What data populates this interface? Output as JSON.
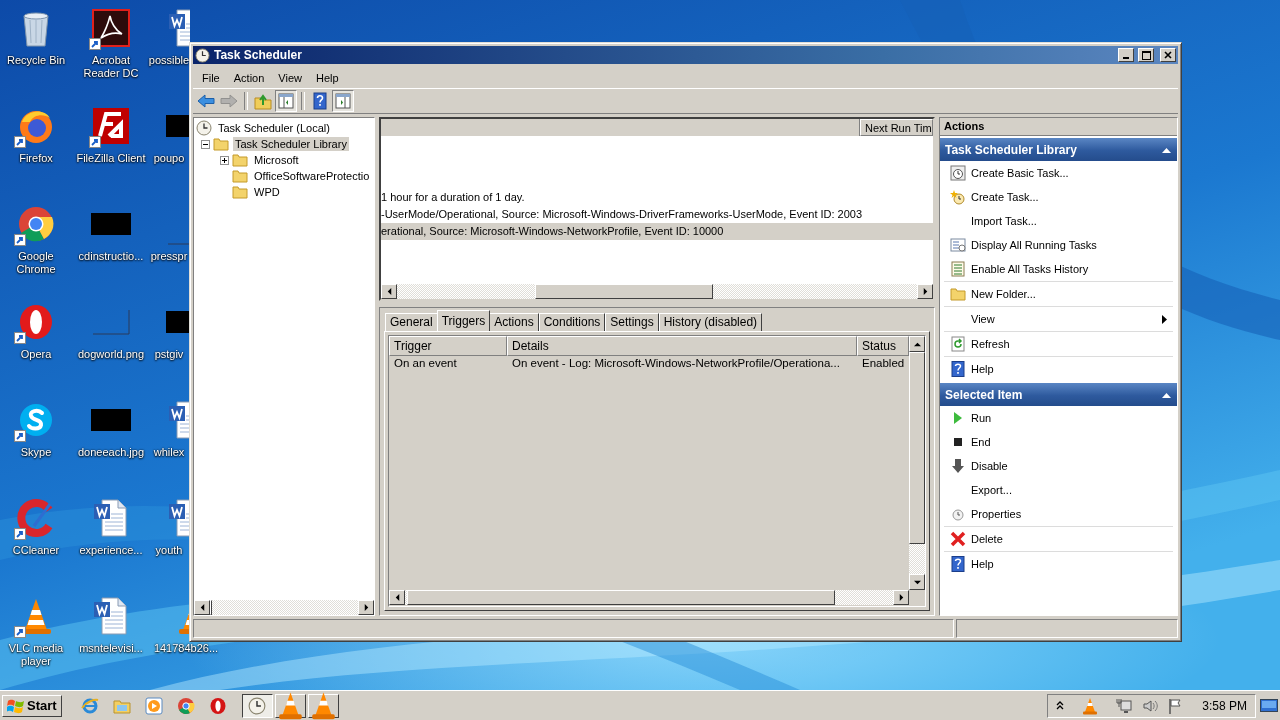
{
  "desktop": {
    "columns": [
      [
        {
          "label": "Recycle Bin",
          "shortcut": false
        },
        {
          "label": "Firefox",
          "shortcut": true
        },
        {
          "label": "Google Chrome",
          "shortcut": true
        },
        {
          "label": "Opera",
          "shortcut": true
        },
        {
          "label": "Skype",
          "shortcut": true
        },
        {
          "label": "CCleaner",
          "shortcut": true
        },
        {
          "label": "VLC media player",
          "shortcut": true
        }
      ],
      [
        {
          "label": "Acrobat Reader DC",
          "shortcut": true
        },
        {
          "label": "FileZilla Client",
          "shortcut": true
        },
        {
          "label": "cdinstructio...",
          "shortcut": false
        },
        {
          "label": "dogworld.png",
          "shortcut": false
        },
        {
          "label": "doneeach.jpg",
          "shortcut": false
        },
        {
          "label": "experience...",
          "shortcut": false
        },
        {
          "label": "msntelevisi...",
          "shortcut": false
        }
      ],
      [
        {
          "label": "possible",
          "shortcut": false
        },
        {
          "label": "poupo",
          "shortcut": false
        },
        {
          "label": "presspr",
          "shortcut": false
        },
        {
          "label": "pstgiv",
          "shortcut": false
        },
        {
          "label": "whilex",
          "shortcut": false
        },
        {
          "label": "youth",
          "shortcut": false
        },
        {
          "label": "141784b26...",
          "shortcut": false
        }
      ]
    ]
  },
  "window": {
    "title": "Task Scheduler",
    "menu": [
      "File",
      "Action",
      "View",
      "Help"
    ],
    "toolbar": [
      {
        "disabled": false,
        "pressed": false
      },
      {
        "disabled": true,
        "pressed": false
      },
      {
        "disabled": false,
        "pressed": false
      },
      {
        "disabled": false,
        "pressed": true
      },
      {
        "disabled": false,
        "pressed": false
      },
      {
        "disabled": false,
        "pressed": true
      }
    ],
    "tree": [
      {
        "label": "Task Scheduler (Local)",
        "selected": false,
        "children": [
          {
            "label": "Task Scheduler Library",
            "selected": true,
            "expanded": true,
            "children": [
              {
                "label": "Microsoft",
                "selected": false,
                "expanded": false
              },
              {
                "label": "OfficeSoftwareProtectio",
                "selected": false
              },
              {
                "label": "WPD",
                "selected": false
              }
            ]
          }
        ]
      }
    ],
    "task_list": {
      "columns": [
        "Next Run Tim"
      ],
      "rows": [
        {
          "text": "1 hour for a duration of 1 day.",
          "selected": false
        },
        {
          "text": "-UserMode/Operational, Source: Microsoft-Windows-DriverFrameworks-UserMode, Event ID: 2003",
          "selected": false
        },
        {
          "text": "erational, Source: Microsoft-Windows-NetworkProfile, Event ID: 10000",
          "selected": true
        }
      ]
    },
    "tabs": [
      {
        "label": "General",
        "selected": false
      },
      {
        "label": "Triggers",
        "selected": true
      },
      {
        "label": "Actions",
        "selected": false
      },
      {
        "label": "Conditions",
        "selected": false
      },
      {
        "label": "Settings",
        "selected": false
      },
      {
        "label": "History (disabled)",
        "selected": false
      }
    ],
    "triggers": {
      "columns": [
        "Trigger",
        "Details",
        "Status"
      ],
      "rows": [
        [
          "On an event",
          "On event - Log: Microsoft-Windows-NetworkProfile/Operationa...",
          "Enabled"
        ]
      ]
    },
    "actions": {
      "title": "Actions",
      "sections": [
        {
          "title": "Task Scheduler Library",
          "expanded": true,
          "groups": [
            [
              {
                "label": "Create Basic Task..."
              },
              {
                "label": "Create Task..."
              },
              {
                "label": "Import Task..."
              },
              {
                "label": "Display All Running Tasks"
              },
              {
                "label": "Enable All Tasks History"
              }
            ],
            [
              {
                "label": "New Folder..."
              }
            ],
            [
              {
                "label": "View",
                "submenu": true
              }
            ],
            [
              {
                "label": "Refresh"
              }
            ],
            [
              {
                "label": "Help"
              }
            ]
          ]
        },
        {
          "title": "Selected Item",
          "expanded": true,
          "groups": [
            [
              {
                "label": "Run"
              },
              {
                "label": "End"
              },
              {
                "label": "Disable"
              },
              {
                "label": "Export..."
              },
              {
                "label": "Properties"
              }
            ],
            [
              {
                "label": "Delete"
              }
            ],
            [
              {
                "label": "Help"
              }
            ]
          ]
        }
      ]
    }
  },
  "taskbar": {
    "start": "Start",
    "tasks": [
      {
        "selected": true
      },
      {
        "selected": false
      },
      {
        "selected": false
      }
    ],
    "clock": "3:58 PM"
  }
}
